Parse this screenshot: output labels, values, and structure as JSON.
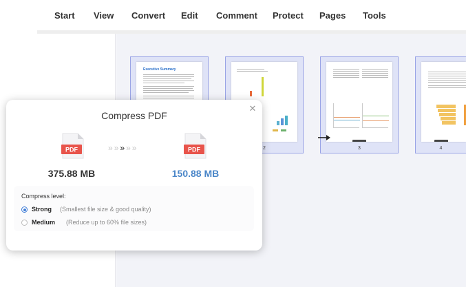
{
  "menu": {
    "items": [
      "Start",
      "View",
      "Convert",
      "Edit",
      "Comment",
      "Protect",
      "Pages",
      "Tools"
    ]
  },
  "thumbnails": {
    "page1_heading": "Executive Summary",
    "page_numbers": [
      "2",
      "3",
      "4"
    ]
  },
  "dialog": {
    "title": "Compress PDF",
    "icon_label": "PDF",
    "size_before": "375.88 MB",
    "size_after": "150.88 MB",
    "chevrons": "» » » » »",
    "compress_level_label": "Compress level:",
    "options": [
      {
        "name": "Strong",
        "desc": "(Smallest file size & good quality)",
        "selected": true
      },
      {
        "name": "Medium",
        "desc": "(Reduce up to  60% file sizes)",
        "selected": false
      }
    ]
  },
  "colors": {
    "accent_blue": "#4a86c8",
    "pdf_red": "#e8544b",
    "thumb_selected": "#dfe3f7"
  }
}
